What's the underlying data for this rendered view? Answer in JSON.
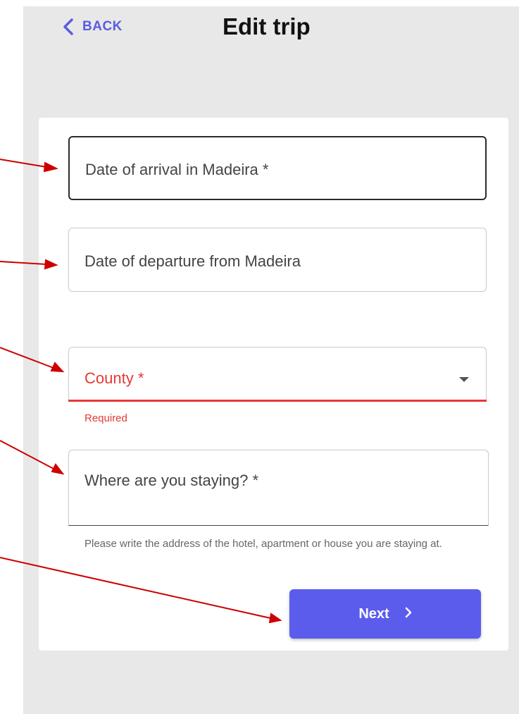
{
  "header": {
    "back_label": "BACK",
    "title": "Edit trip"
  },
  "form": {
    "arrival": {
      "label": "Date of arrival in Madeira *",
      "value": ""
    },
    "departure": {
      "label": "Date of departure from Madeira",
      "value": ""
    },
    "county": {
      "label": "County *",
      "selected": "",
      "error": "Required"
    },
    "staying": {
      "label": "Where are you staying? *",
      "value": "",
      "helper": "Please write the address of the hotel, apartment or house you are staying at."
    },
    "next_label": "Next"
  },
  "icons": {
    "back": "chevron-left-icon",
    "dropdown": "caret-down-icon",
    "next": "chevron-right-icon"
  },
  "colors": {
    "accent": "#5b5cec",
    "error": "#e53935",
    "annotation": "#cc0000",
    "background": "#e8e8e8"
  }
}
